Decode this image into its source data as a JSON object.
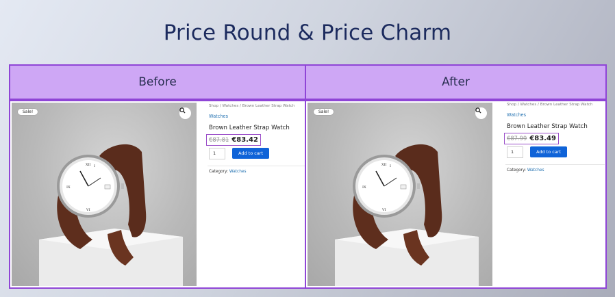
{
  "page": {
    "title": "Price Round & Price Charm"
  },
  "columns": [
    {
      "header": "Before",
      "product": {
        "sale_badge": "Sale!",
        "zoom_icon": "magnifier-icon",
        "breadcrumb": "Shop / Watches / Brown Leather Strap Watch",
        "category_link": "Watches",
        "name": "Brown Leather Strap Watch",
        "price_old": "€87.81",
        "price_new": "€83.42",
        "qty": "1",
        "add_to_cart": "Add to cart",
        "category_label": "Category:",
        "category_value": "Watches"
      }
    },
    {
      "header": "After",
      "product": {
        "sale_badge": "Sale!",
        "zoom_icon": "magnifier-icon",
        "breadcrumb": "Shop / Watches / Brown Leather Strap Watch",
        "category_link": "Watches",
        "name": "Brown Leather Strap Watch",
        "price_old": "€87.99",
        "price_new": "€83.49",
        "qty": "1",
        "add_to_cart": "Add to cart",
        "category_label": "Category:",
        "category_value": "Watches"
      }
    }
  ],
  "colors": {
    "header_bg": "#cea7f5",
    "border": "#8f45d6",
    "title": "#1c2b5e",
    "button": "#0f63d8",
    "link": "#2271b1"
  }
}
